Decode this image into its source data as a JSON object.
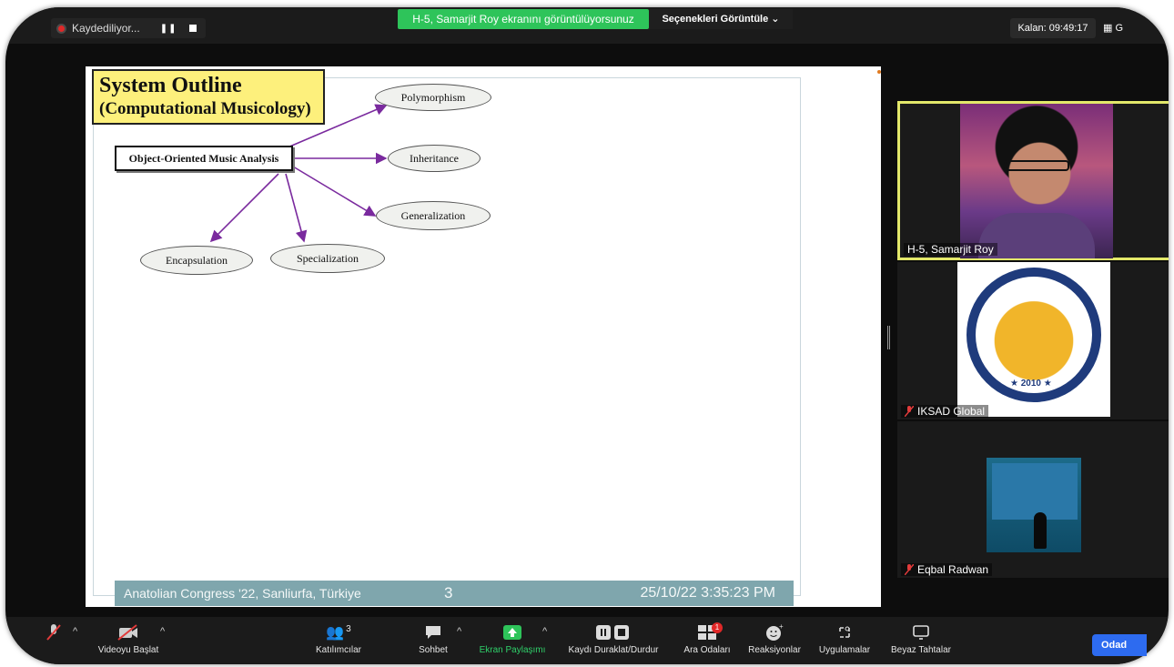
{
  "top_bar": {
    "recording_label": "Kaydediliyor...",
    "share_banner": "H-5, Samarjit Roy ekranını görüntülüyorsunuz",
    "view_options": "Seçenekleri Görüntüle ⌄",
    "timer": "Kalan: 09:49:17",
    "gallery_label": "G"
  },
  "slide": {
    "title_line1": "System Outline",
    "title_line2": "(Computational Musicology)",
    "root_node": "Object-Oriented Music Analysis",
    "nodes": {
      "polymorphism": "Polymorphism",
      "inheritance": "Inheritance",
      "generalization": "Generalization",
      "encapsulation": "Encapsulation",
      "specialization": "Specialization"
    },
    "footer_left": "Anatolian Congress '22, Sanliurfa, Türkiye",
    "footer_page": "3",
    "footer_datetime": "25/10/22 3:35:23 PM"
  },
  "participants": [
    {
      "name": "H-5, Samarjit Roy"
    },
    {
      "name": "IKSAD Global"
    },
    {
      "name": "Eqbal Radwan"
    }
  ],
  "logo": {
    "year": "★ 2010 ★"
  },
  "toolbar": {
    "video_label": "Videoyu Başlat",
    "participants_label": "Katılımcılar",
    "participants_count": "3",
    "chat_label": "Sohbet",
    "share_label": "Ekran Paylaşımı",
    "record_label": "Kaydı Duraklat/Durdur",
    "breakout_label": "Ara Odaları",
    "breakout_badge": "1",
    "reactions_label": "Reaksiyonlar",
    "apps_label": "Uygulamalar",
    "whiteboard_label": "Beyaz Tahtalar",
    "end_label": "Odad"
  },
  "colors": {
    "share_green": "#2ec45a",
    "active_speaker_border": "#e3e86a",
    "arrow_purple": "#7a2a9e",
    "footer_teal": "#7fa6ad",
    "title_yellow": "#fdf07c"
  }
}
